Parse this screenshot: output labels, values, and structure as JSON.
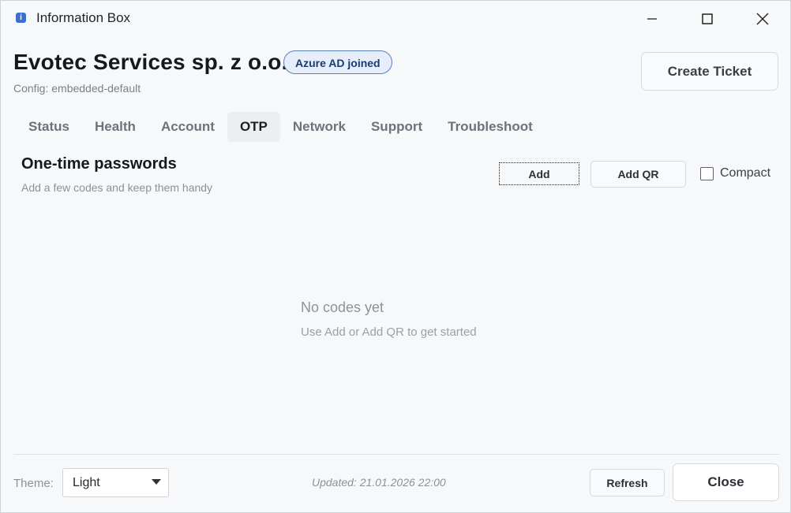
{
  "window": {
    "title": "Information Box",
    "icon": "info-icon",
    "controls": [
      "minimize-icon",
      "maximize-icon",
      "close-icon"
    ]
  },
  "header": {
    "company": "Evotec Services sp. z o.o.",
    "badge": "Azure AD joined",
    "config": "Config: embedded-default",
    "create_ticket_label": "Create Ticket"
  },
  "tabs": [
    {
      "label": "Status",
      "active": false
    },
    {
      "label": "Health",
      "active": false
    },
    {
      "label": "Account",
      "active": false
    },
    {
      "label": "OTP",
      "active": true
    },
    {
      "label": "Network",
      "active": false
    },
    {
      "label": "Support",
      "active": false
    },
    {
      "label": "Troubleshoot",
      "active": false
    }
  ],
  "otp": {
    "title": "One-time passwords",
    "subtitle": "Add a few codes and keep them handy",
    "add_label": "Add",
    "add_qr_label": "Add QR",
    "compact_label": "Compact",
    "compact_checked": false,
    "empty_title": "No codes yet",
    "empty_subtitle": "Use Add or Add QR to get started"
  },
  "footer": {
    "theme_label": "Theme:",
    "theme_value": "Light",
    "updated": "Updated: 21.01.2026 22:00",
    "refresh_label": "Refresh",
    "close_label": "Close"
  },
  "colors": {
    "accent": "#3b6fd4",
    "badge_bg": "#e6eefb",
    "badge_border": "#5b7fb8",
    "background": "#f7f8fa"
  }
}
